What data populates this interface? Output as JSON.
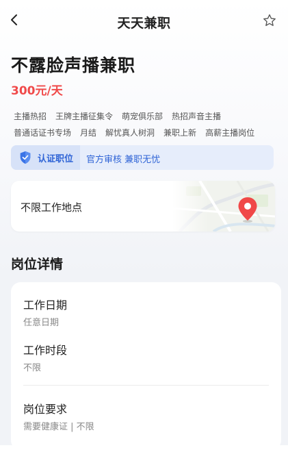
{
  "nav": {
    "title": "天天兼职",
    "back_icon": "chevron-left-icon",
    "favorite_icon": "star-outline-icon"
  },
  "job": {
    "title": "不露脸声播兼职",
    "salary": "300元/天",
    "tags_row1": [
      "主播热招",
      "王牌主播征集令",
      "萌宠俱乐部",
      "热招声音主播"
    ],
    "tags_row2": [
      "普通话证书专场",
      "月结",
      "解忧真人树洞",
      "兼职上新",
      "高薪主播岗位"
    ]
  },
  "certified": {
    "icon": "shield-check-icon",
    "label": "认证职位",
    "description": "官方审核 兼职无忧"
  },
  "location": {
    "text": "不限工作地点",
    "map_pin_icon": "map-pin-icon"
  },
  "details": {
    "heading": "岗位详情",
    "items": [
      {
        "label": "工作日期",
        "value": "任意日期"
      },
      {
        "label": "工作时段",
        "value": "不限"
      },
      {
        "label": "岗位要求",
        "value": "需要健康证 | 不限"
      }
    ]
  },
  "colors": {
    "salary": "#f04a4a",
    "accent_blue": "#2f64d6",
    "pin_red": "#f04848"
  }
}
